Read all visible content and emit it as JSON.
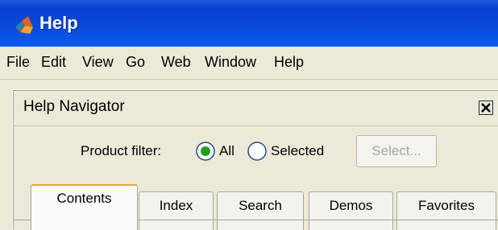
{
  "window": {
    "title": "Help",
    "icon": "matlab-membrane-icon"
  },
  "menu": [
    "File",
    "Edit",
    "View",
    "Go",
    "Web",
    "Window",
    "Help"
  ],
  "navigator": {
    "title": "Help Navigator",
    "close_icon": "close-icon",
    "product_filter_label": "Product filter:",
    "radio_all_label": "All",
    "radio_selected_label": "Selected",
    "selected_option": "All",
    "select_button_label": "Select...",
    "tabs": [
      "Contents",
      "Index",
      "Search",
      "Demos",
      "Favorites"
    ],
    "active_tab": "Contents"
  },
  "colors": {
    "titlebar": "#0a3fd4",
    "radio_dot": "#21a121",
    "active_tab_accent": "#e2a83b"
  }
}
